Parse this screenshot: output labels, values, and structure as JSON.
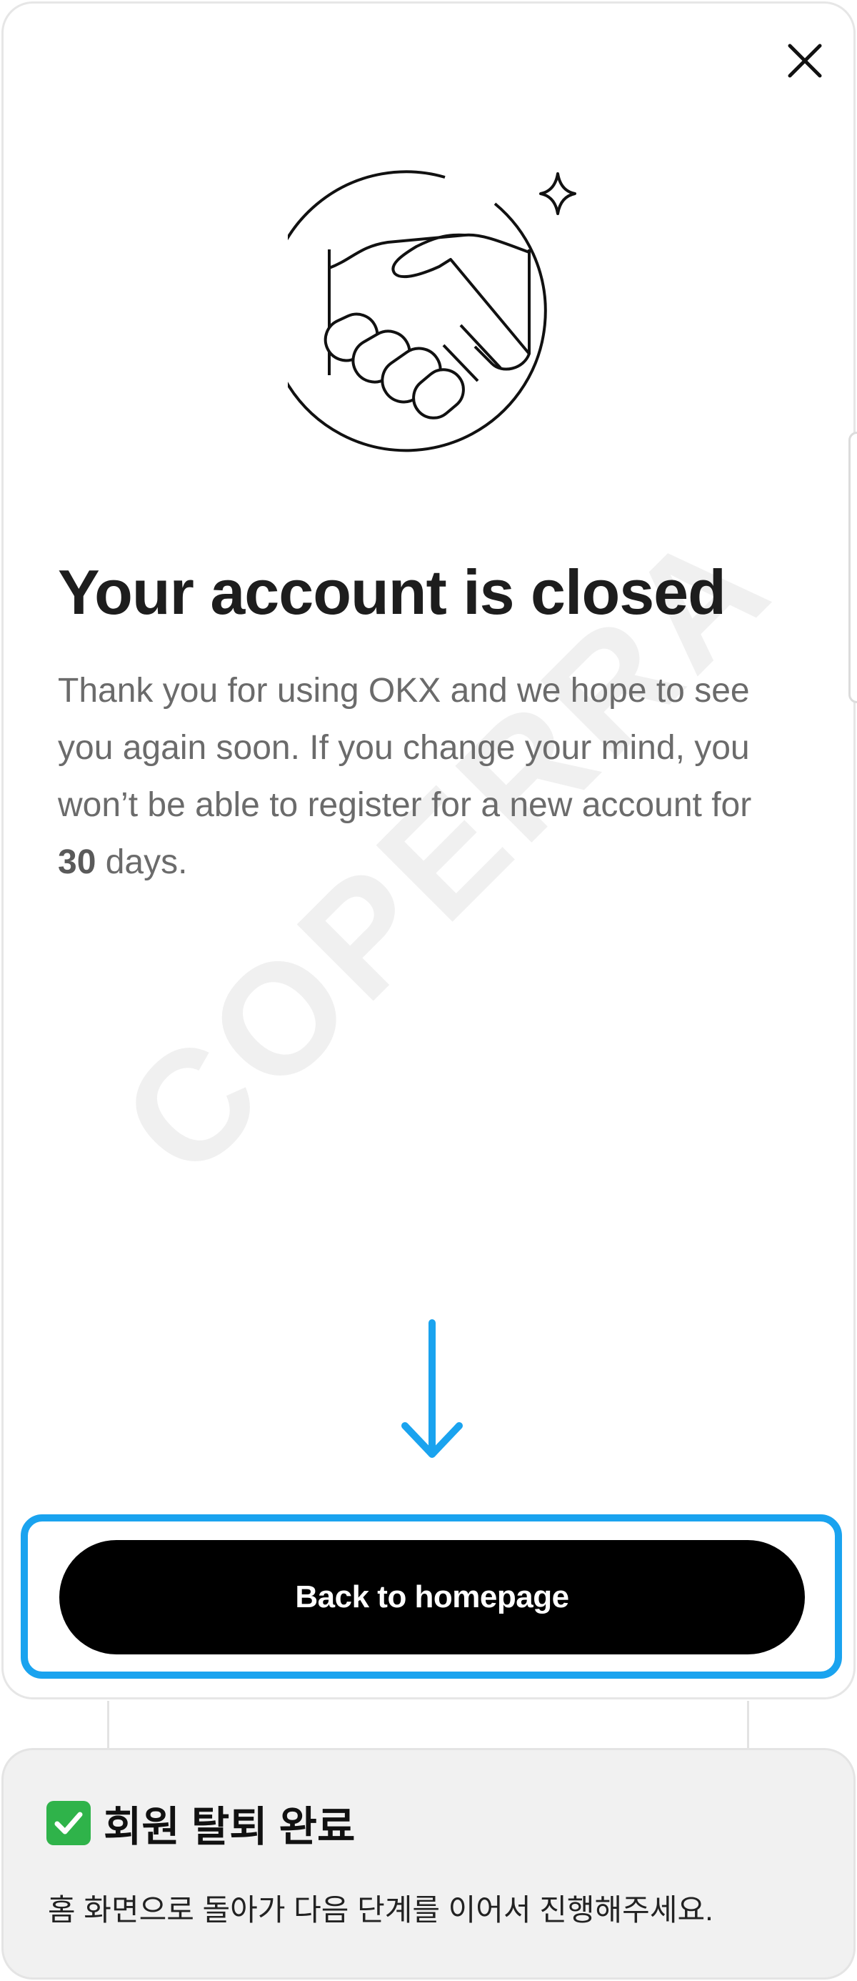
{
  "dialog": {
    "close_label": "×",
    "title": "Your account is closed",
    "description_before": "Thank you for using OKX and we hope to see you again soon. If you change your mind, you won’t be able to register for a new account for ",
    "description_days": "30",
    "description_after": " days.",
    "primary_button": "Back to homepage",
    "watermark": "COPERRA"
  },
  "annotation": {
    "title": "회원 탈퇴 완료",
    "description": "홈 화면으로 돌아가 다음 단계를 이어서 진행해주세요."
  },
  "colors": {
    "highlight": "#1aa3ef",
    "button_bg": "#000000",
    "button_text": "#ffffff",
    "check_green": "#2fb34a"
  },
  "icons": {
    "close": "close-icon",
    "hero": "handshake-illustration",
    "sparkle": "sparkle-icon",
    "arrow": "arrow-down-icon",
    "check": "check-mark-icon"
  }
}
